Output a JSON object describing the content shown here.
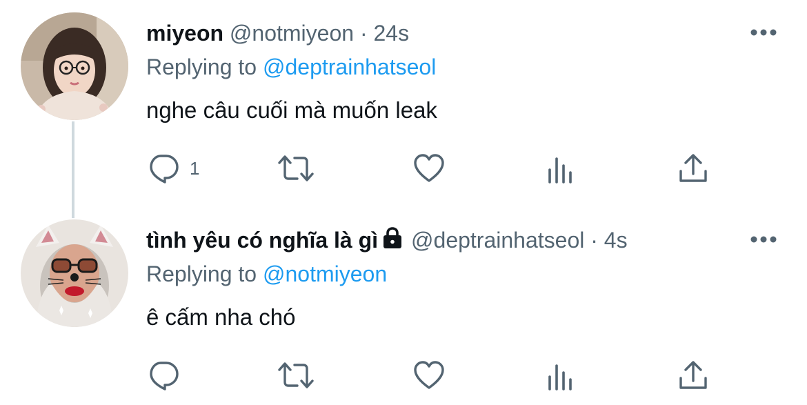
{
  "tweets": [
    {
      "name": "miyeon",
      "handle": "@notmiyeon",
      "separator": "·",
      "time": "24s",
      "replying_prefix": "Replying to",
      "replying_to": "@deptrainhatseol",
      "text": "nghe câu cuối mà muốn leak",
      "reply_count": "1",
      "locked": false
    },
    {
      "name": "tình yêu có nghĩa là gì",
      "handle": "@deptrainhatseol",
      "separator": "·",
      "time": "4s",
      "replying_prefix": "Replying to",
      "replying_to": "@notmiyeon",
      "text": "ê cấm nha chó",
      "reply_count": "",
      "locked": true
    }
  ],
  "icons": {
    "more": "more-horizontal-icon",
    "reply": "reply-icon",
    "retweet": "retweet-icon",
    "like": "heart-icon",
    "views": "analytics-icon",
    "share": "share-icon",
    "lock": "lock-icon"
  },
  "colors": {
    "text": "#0f1419",
    "secondary": "#536471",
    "link": "#1d9bf0",
    "thread_line": "#cfd9de"
  }
}
